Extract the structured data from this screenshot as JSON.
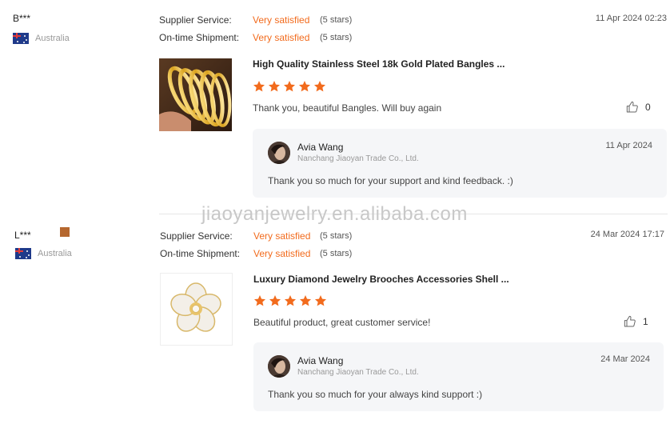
{
  "reviews": [
    {
      "reviewer": "B***",
      "country": "Australia",
      "supplier_label": "Supplier Service:",
      "supplier_value": "Very satisfied",
      "supplier_stars": "(5 stars)",
      "shipment_label": "On-time Shipment:",
      "shipment_value": "Very satisfied",
      "shipment_stars": "(5 stars)",
      "date": "11 Apr 2024 02:23",
      "product_title": "High Quality Stainless Steel 18k Gold Plated Bangles ...",
      "rating": 5,
      "text": "Thank you, beautiful Bangles.  Will buy again",
      "likes": "0",
      "reply": {
        "name": "Avia Wang",
        "company": "Nanchang Jiaoyan Trade Co., Ltd.",
        "date": "11 Apr 2024",
        "text": "Thank you so much for your support and kind feedback. :)"
      }
    },
    {
      "reviewer": "L***",
      "country": "Australia",
      "supplier_label": "Supplier Service:",
      "supplier_value": "Very satisfied",
      "supplier_stars": "(5 stars)",
      "shipment_label": "On-time Shipment:",
      "shipment_value": "Very satisfied",
      "shipment_stars": "(5 stars)",
      "date": "24 Mar 2024 17:17",
      "product_title": "Luxury Diamond Jewelry Brooches Accessories Shell ...",
      "rating": 5,
      "text": "Beautiful product, great customer service!",
      "likes": "1",
      "reply": {
        "name": "Avia Wang",
        "company": "Nanchang Jiaoyan Trade Co., Ltd.",
        "date": "24 Mar 2024",
        "text": "Thank you so much for your always kind support :)"
      }
    }
  ],
  "watermark": "jiaoyanjewelry.en.alibaba.com",
  "colors": {
    "accent": "#f26b1d",
    "reply_bg": "#f5f6f8",
    "badge": "#b5672e"
  }
}
